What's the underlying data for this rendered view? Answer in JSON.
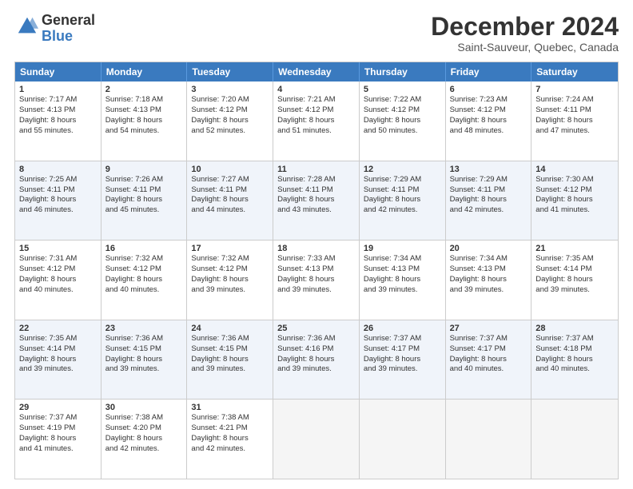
{
  "logo": {
    "general": "General",
    "blue": "Blue"
  },
  "title": "December 2024",
  "location": "Saint-Sauveur, Quebec, Canada",
  "headers": [
    "Sunday",
    "Monday",
    "Tuesday",
    "Wednesday",
    "Thursday",
    "Friday",
    "Saturday"
  ],
  "weeks": [
    [
      {
        "day": "1",
        "lines": [
          "Sunrise: 7:17 AM",
          "Sunset: 4:13 PM",
          "Daylight: 8 hours",
          "and 55 minutes."
        ]
      },
      {
        "day": "2",
        "lines": [
          "Sunrise: 7:18 AM",
          "Sunset: 4:13 PM",
          "Daylight: 8 hours",
          "and 54 minutes."
        ]
      },
      {
        "day": "3",
        "lines": [
          "Sunrise: 7:20 AM",
          "Sunset: 4:12 PM",
          "Daylight: 8 hours",
          "and 52 minutes."
        ]
      },
      {
        "day": "4",
        "lines": [
          "Sunrise: 7:21 AM",
          "Sunset: 4:12 PM",
          "Daylight: 8 hours",
          "and 51 minutes."
        ]
      },
      {
        "day": "5",
        "lines": [
          "Sunrise: 7:22 AM",
          "Sunset: 4:12 PM",
          "Daylight: 8 hours",
          "and 50 minutes."
        ]
      },
      {
        "day": "6",
        "lines": [
          "Sunrise: 7:23 AM",
          "Sunset: 4:12 PM",
          "Daylight: 8 hours",
          "and 48 minutes."
        ]
      },
      {
        "day": "7",
        "lines": [
          "Sunrise: 7:24 AM",
          "Sunset: 4:11 PM",
          "Daylight: 8 hours",
          "and 47 minutes."
        ]
      }
    ],
    [
      {
        "day": "8",
        "lines": [
          "Sunrise: 7:25 AM",
          "Sunset: 4:11 PM",
          "Daylight: 8 hours",
          "and 46 minutes."
        ]
      },
      {
        "day": "9",
        "lines": [
          "Sunrise: 7:26 AM",
          "Sunset: 4:11 PM",
          "Daylight: 8 hours",
          "and 45 minutes."
        ]
      },
      {
        "day": "10",
        "lines": [
          "Sunrise: 7:27 AM",
          "Sunset: 4:11 PM",
          "Daylight: 8 hours",
          "and 44 minutes."
        ]
      },
      {
        "day": "11",
        "lines": [
          "Sunrise: 7:28 AM",
          "Sunset: 4:11 PM",
          "Daylight: 8 hours",
          "and 43 minutes."
        ]
      },
      {
        "day": "12",
        "lines": [
          "Sunrise: 7:29 AM",
          "Sunset: 4:11 PM",
          "Daylight: 8 hours",
          "and 42 minutes."
        ]
      },
      {
        "day": "13",
        "lines": [
          "Sunrise: 7:29 AM",
          "Sunset: 4:11 PM",
          "Daylight: 8 hours",
          "and 42 minutes."
        ]
      },
      {
        "day": "14",
        "lines": [
          "Sunrise: 7:30 AM",
          "Sunset: 4:12 PM",
          "Daylight: 8 hours",
          "and 41 minutes."
        ]
      }
    ],
    [
      {
        "day": "15",
        "lines": [
          "Sunrise: 7:31 AM",
          "Sunset: 4:12 PM",
          "Daylight: 8 hours",
          "and 40 minutes."
        ]
      },
      {
        "day": "16",
        "lines": [
          "Sunrise: 7:32 AM",
          "Sunset: 4:12 PM",
          "Daylight: 8 hours",
          "and 40 minutes."
        ]
      },
      {
        "day": "17",
        "lines": [
          "Sunrise: 7:32 AM",
          "Sunset: 4:12 PM",
          "Daylight: 8 hours",
          "and 39 minutes."
        ]
      },
      {
        "day": "18",
        "lines": [
          "Sunrise: 7:33 AM",
          "Sunset: 4:13 PM",
          "Daylight: 8 hours",
          "and 39 minutes."
        ]
      },
      {
        "day": "19",
        "lines": [
          "Sunrise: 7:34 AM",
          "Sunset: 4:13 PM",
          "Daylight: 8 hours",
          "and 39 minutes."
        ]
      },
      {
        "day": "20",
        "lines": [
          "Sunrise: 7:34 AM",
          "Sunset: 4:13 PM",
          "Daylight: 8 hours",
          "and 39 minutes."
        ]
      },
      {
        "day": "21",
        "lines": [
          "Sunrise: 7:35 AM",
          "Sunset: 4:14 PM",
          "Daylight: 8 hours",
          "and 39 minutes."
        ]
      }
    ],
    [
      {
        "day": "22",
        "lines": [
          "Sunrise: 7:35 AM",
          "Sunset: 4:14 PM",
          "Daylight: 8 hours",
          "and 39 minutes."
        ]
      },
      {
        "day": "23",
        "lines": [
          "Sunrise: 7:36 AM",
          "Sunset: 4:15 PM",
          "Daylight: 8 hours",
          "and 39 minutes."
        ]
      },
      {
        "day": "24",
        "lines": [
          "Sunrise: 7:36 AM",
          "Sunset: 4:15 PM",
          "Daylight: 8 hours",
          "and 39 minutes."
        ]
      },
      {
        "day": "25",
        "lines": [
          "Sunrise: 7:36 AM",
          "Sunset: 4:16 PM",
          "Daylight: 8 hours",
          "and 39 minutes."
        ]
      },
      {
        "day": "26",
        "lines": [
          "Sunrise: 7:37 AM",
          "Sunset: 4:17 PM",
          "Daylight: 8 hours",
          "and 39 minutes."
        ]
      },
      {
        "day": "27",
        "lines": [
          "Sunrise: 7:37 AM",
          "Sunset: 4:17 PM",
          "Daylight: 8 hours",
          "and 40 minutes."
        ]
      },
      {
        "day": "28",
        "lines": [
          "Sunrise: 7:37 AM",
          "Sunset: 4:18 PM",
          "Daylight: 8 hours",
          "and 40 minutes."
        ]
      }
    ],
    [
      {
        "day": "29",
        "lines": [
          "Sunrise: 7:37 AM",
          "Sunset: 4:19 PM",
          "Daylight: 8 hours",
          "and 41 minutes."
        ]
      },
      {
        "day": "30",
        "lines": [
          "Sunrise: 7:38 AM",
          "Sunset: 4:20 PM",
          "Daylight: 8 hours",
          "and 42 minutes."
        ]
      },
      {
        "day": "31",
        "lines": [
          "Sunrise: 7:38 AM",
          "Sunset: 4:21 PM",
          "Daylight: 8 hours",
          "and 42 minutes."
        ]
      },
      {
        "day": "",
        "lines": []
      },
      {
        "day": "",
        "lines": []
      },
      {
        "day": "",
        "lines": []
      },
      {
        "day": "",
        "lines": []
      }
    ]
  ]
}
